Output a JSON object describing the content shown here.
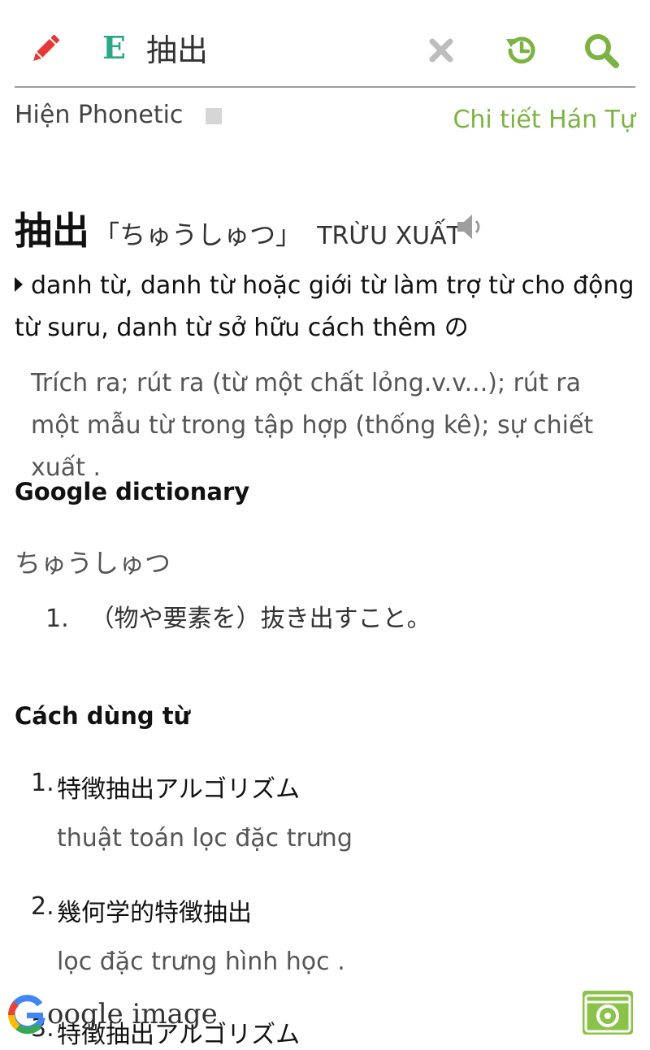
{
  "search": {
    "lang_badge": "E",
    "query": "抽出"
  },
  "colors": {
    "accent_green": "#7cb342",
    "lang_teal": "#2aa886",
    "edit_red": "#e53935"
  },
  "icons": {
    "edit": "pencil-icon",
    "clear": "close-icon",
    "history": "history-icon",
    "search": "search-icon",
    "speaker": "speaker-icon",
    "camera": "camera-icon"
  },
  "options": {
    "phonetic_label": "Hiện Phonetic",
    "phonetic_checked": false,
    "kanji_detail_link": "Chi tiết Hán Tự"
  },
  "entry": {
    "word": "抽出",
    "reading": "「ちゅうしゅつ」",
    "hanviet": "TRỪU XUẤT",
    "part_of_speech": "danh từ, danh từ hoặc giới từ làm trợ từ cho động từ suru, danh từ sở hữu cách thêm の",
    "meaning": "Trích ra; rút ra (từ một chất lỏng.v.v...); rút ra một mẫu từ trong tập hợp (thống kê); sự chiết xuất ."
  },
  "google_dictionary": {
    "title": "Google dictionary",
    "reading": "ちゅうしゅつ",
    "definitions": [
      {
        "num": "1.",
        "text": "（物や要素を）抜き出すこと。"
      }
    ]
  },
  "usage": {
    "title": "Cách dùng từ",
    "examples": [
      {
        "num": "1.",
        "jp": "特徴抽出アルゴリズム",
        "vi": "thuật toán lọc đặc trưng"
      },
      {
        "num": "2.",
        "jp": "幾何学的特徴抽出",
        "vi": "lọc đặc trưng hình học ."
      },
      {
        "num": "3.",
        "jp": "特徴抽出アルゴリズム",
        "vi": ""
      }
    ]
  },
  "footer": {
    "google_image_label": "oogle image"
  }
}
